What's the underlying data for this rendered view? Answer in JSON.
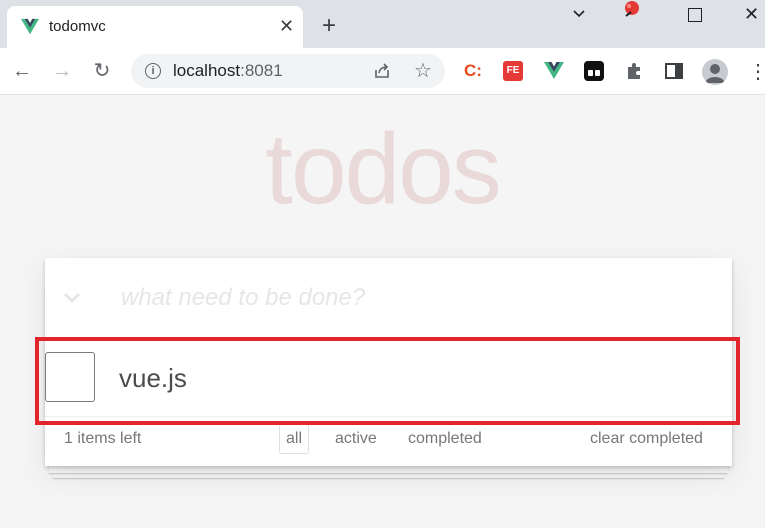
{
  "browser": {
    "tab_title": "todomvc",
    "tab_close": "✕",
    "new_tab": "+",
    "url_host": "localhost",
    "url_port": ":8081",
    "extensions": {
      "c_label": "C:",
      "fe_label": "FE"
    },
    "accent_colors": {
      "vue_green": "#41b883",
      "fe_red": "#e53935",
      "highlight": "#e3242b"
    }
  },
  "app": {
    "title": "todos",
    "new_todo_placeholder": "what need to be done?",
    "todos": [
      {
        "label": "vue.js",
        "completed": false
      }
    ],
    "footer": {
      "count_text": "1 items left",
      "filters": [
        "all",
        "active",
        "completed"
      ],
      "selected_filter": "all",
      "clear_label": "clear completed"
    }
  }
}
